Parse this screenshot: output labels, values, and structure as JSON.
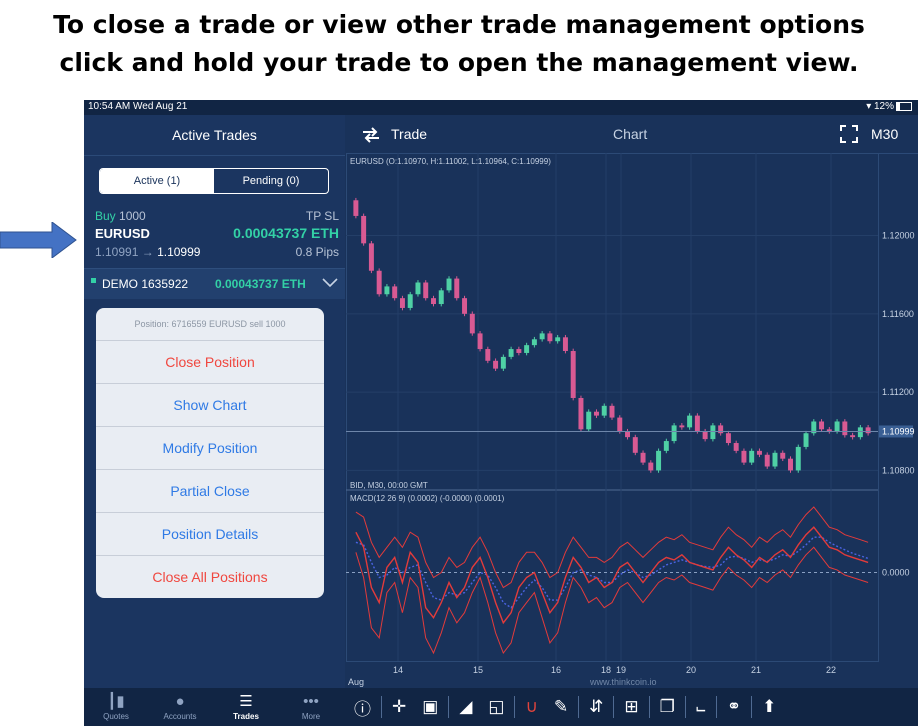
{
  "caption": {
    "line1": "To close a trade or view other trade management options",
    "line2": "click and hold your trade to open the management view."
  },
  "status": {
    "time": "10:54 AM   Wed Aug 21",
    "battery": "▾ 12%"
  },
  "left_panel": {
    "title": "Active Trades",
    "segments": [
      "Active (1)",
      "Pending (0)"
    ],
    "trade": {
      "side": "Buy",
      "size": "1000",
      "tpsl": "TP SL",
      "symbol": "EURUSD",
      "profit": "0.00043737 ETH",
      "prices": "1.10991 →",
      "current": "1.10999",
      "pips": "0.8 Pips"
    },
    "account": {
      "label": "DEMO 1635922",
      "value": "0.00043737 ETH"
    }
  },
  "popup": {
    "title": "Position: 6716559 EURUSD sell 1000",
    "options": [
      "Close Position",
      "Show Chart",
      "Modify Position",
      "Partial Close",
      "Position Details",
      "Close All Positions"
    ]
  },
  "tabbar": {
    "tabs": [
      {
        "label": "Quotes",
        "icon": "quotes-icon"
      },
      {
        "label": "Accounts",
        "icon": "accounts-icon"
      },
      {
        "label": "Trades",
        "icon": "trades-icon"
      },
      {
        "label": "More",
        "icon": "more-icon"
      }
    ],
    "tools": [
      "info-icon",
      "crosshair-icon",
      "rectangle-icon",
      "mountain-chart-icon",
      "fibonacci-icon",
      "magnet-icon",
      "pencil-icon",
      "sort-icon",
      "grid-icon",
      "copy-icon",
      "indicator-chart-icon",
      "link-icon",
      "share-icon"
    ]
  },
  "chart_header": {
    "trade_label": "Trade",
    "title": "Chart",
    "timeframe": "M30"
  },
  "chart_data": {
    "type": "line",
    "symbol_info": "EURUSD (O:1.10970, H:1.11002, L:1.10964, C:1.10999)",
    "price_axis": [
      "1.12000",
      "1.11600",
      "1.11200",
      "1.10800"
    ],
    "price_range": [
      1.107,
      1.1235
    ],
    "current_price": "1.10999",
    "bid_label": "BID, M30, 00:00 GMT",
    "macd_label": "MACD(12 26 9) (0.0002) (-0.0000) (0.0001)",
    "macd_zero": "0.0000",
    "x_ticks": [
      "14",
      "15",
      "16",
      "18",
      "19",
      "20",
      "21",
      "22"
    ],
    "x_sublabel": "Aug",
    "close": [
      1.121,
      1.1196,
      1.1182,
      1.117,
      1.1174,
      1.1168,
      1.1163,
      1.117,
      1.1176,
      1.1168,
      1.1165,
      1.1172,
      1.1178,
      1.1168,
      1.116,
      1.115,
      1.1142,
      1.1136,
      1.1132,
      1.1138,
      1.1142,
      1.114,
      1.1144,
      1.1147,
      1.115,
      1.1146,
      1.1148,
      1.1141,
      1.1117,
      1.1101,
      1.111,
      1.1108,
      1.1113,
      1.1107,
      1.11,
      1.1097,
      1.1089,
      1.1084,
      1.108,
      1.109,
      1.1095,
      1.1103,
      1.1102,
      1.1108,
      1.11,
      1.1096,
      1.1103,
      1.1099,
      1.1094,
      1.109,
      1.1084,
      1.109,
      1.1088,
      1.1082,
      1.1089,
      1.1086,
      1.108,
      1.1092,
      1.1099,
      1.1105,
      1.1101,
      1.11,
      1.1105,
      1.1098,
      1.1097,
      1.1102,
      1.1099
    ],
    "macd": [
      0.8,
      0.5,
      -0.3,
      -0.6,
      0.1,
      0.3,
      -0.2,
      0.4,
      0.2,
      -0.7,
      -0.9,
      -0.6,
      -0.2,
      -0.5,
      -0.3,
      0.1,
      0.3,
      -0.1,
      -0.6,
      -1.0,
      -0.8,
      -0.3,
      -0.1,
      0.0,
      -0.4,
      -0.8,
      -0.6,
      -0.1,
      0.3,
      0.1,
      -0.2,
      -0.1,
      -0.3,
      -0.2,
      0.1,
      0.2,
      0.0,
      -0.2,
      0.0,
      0.2,
      0.3,
      0.25,
      0.35,
      0.2,
      0.15,
      0.1,
      0.05,
      0.3,
      0.5,
      0.35,
      0.25,
      0.1,
      0.3,
      0.2,
      0.35,
      0.45,
      0.3,
      0.55,
      0.75,
      0.9,
      0.7,
      0.5,
      0.45,
      0.35,
      0.3,
      0.25,
      0.2
    ],
    "signal": [
      0.6,
      0.55,
      0.2,
      -0.1,
      -0.05,
      0.1,
      0.0,
      0.1,
      0.15,
      -0.2,
      -0.5,
      -0.55,
      -0.4,
      -0.45,
      -0.4,
      -0.2,
      0.0,
      -0.05,
      -0.3,
      -0.6,
      -0.7,
      -0.5,
      -0.3,
      -0.15,
      -0.3,
      -0.55,
      -0.55,
      -0.3,
      0.0,
      0.05,
      -0.05,
      -0.1,
      -0.2,
      -0.2,
      -0.05,
      0.05,
      0.0,
      -0.1,
      -0.05,
      0.05,
      0.15,
      0.2,
      0.25,
      0.2,
      0.15,
      0.12,
      0.1,
      0.15,
      0.3,
      0.32,
      0.28,
      0.2,
      0.25,
      0.22,
      0.27,
      0.35,
      0.32,
      0.42,
      0.55,
      0.7,
      0.7,
      0.6,
      0.52,
      0.45,
      0.38,
      0.33,
      0.28
    ],
    "band_upper": [
      1.2,
      1.1,
      0.6,
      0.3,
      0.5,
      0.7,
      0.5,
      0.8,
      0.7,
      0.2,
      -0.1,
      0.0,
      0.3,
      0.1,
      0.2,
      0.5,
      0.7,
      0.4,
      0.0,
      -0.3,
      -0.2,
      0.2,
      0.4,
      0.4,
      0.2,
      -0.1,
      0.0,
      0.4,
      0.7,
      0.5,
      0.3,
      0.3,
      0.2,
      0.3,
      0.5,
      0.6,
      0.45,
      0.3,
      0.45,
      0.6,
      0.7,
      0.65,
      0.75,
      0.6,
      0.55,
      0.5,
      0.45,
      0.7,
      0.9,
      0.75,
      0.65,
      0.5,
      0.7,
      0.6,
      0.75,
      0.85,
      0.7,
      0.95,
      1.15,
      1.3,
      1.1,
      0.9,
      0.85,
      0.75,
      0.7,
      0.65,
      0.6
    ],
    "band_lower": [
      0.4,
      -0.1,
      -1.1,
      -1.3,
      -0.4,
      -0.2,
      -0.8,
      -0.1,
      -0.3,
      -1.3,
      -1.6,
      -1.2,
      -0.7,
      -1.0,
      -0.8,
      -0.4,
      -0.1,
      -0.6,
      -1.2,
      -1.6,
      -1.4,
      -0.8,
      -0.6,
      -0.4,
      -0.9,
      -1.4,
      -1.2,
      -0.6,
      -0.1,
      -0.3,
      -0.6,
      -0.5,
      -0.7,
      -0.6,
      -0.3,
      -0.2,
      -0.4,
      -0.6,
      -0.4,
      -0.2,
      -0.1,
      -0.15,
      -0.05,
      -0.2,
      -0.25,
      -0.3,
      -0.35,
      -0.1,
      0.1,
      -0.05,
      -0.15,
      -0.3,
      -0.1,
      -0.2,
      -0.05,
      0.05,
      -0.1,
      0.15,
      0.35,
      0.5,
      0.3,
      0.1,
      0.05,
      -0.05,
      -0.1,
      -0.15,
      -0.2
    ]
  },
  "colors": {
    "green": "#33d1a6",
    "pink": "#e0608f",
    "bull": "#4fd1a5",
    "bear": "#d85a93",
    "macd_line": "#e23b3b",
    "signal_line": "#4a63e0",
    "background": "#19325a"
  },
  "brand": "www.thinkcoin.io"
}
